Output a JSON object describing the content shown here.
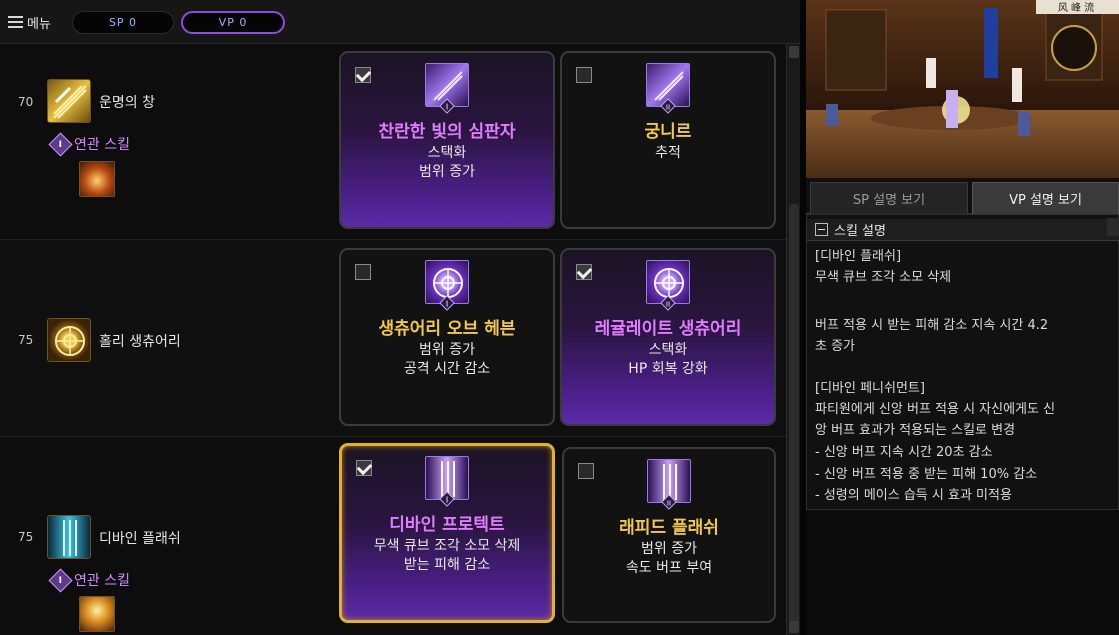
{
  "topbar": {
    "menu_label": "메뉴",
    "sp_label": "SP 0",
    "vp_label": "VP 0"
  },
  "rows": [
    {
      "level": "70",
      "skill_name": "운명의 창",
      "related_label": "연관 스킬",
      "related_roman": "I",
      "cards": [
        {
          "checked": true,
          "roman": "I",
          "title": "찬란한 빛의 심판자",
          "lines": [
            "스택화",
            "범위 증가"
          ]
        },
        {
          "checked": false,
          "roman": "II",
          "title": "궁니르",
          "lines": [
            "추적"
          ]
        }
      ]
    },
    {
      "level": "75",
      "skill_name": "홀리 생츄어리",
      "cards": [
        {
          "checked": false,
          "roman": "I",
          "title": "생츄어리 오브 헤븐",
          "lines": [
            "범위 증가",
            "공격 시간 감소"
          ]
        },
        {
          "checked": true,
          "roman": "II",
          "title": "레귤레이트 생츄어리",
          "lines": [
            "스택화",
            "HP 회복 강화"
          ]
        }
      ]
    },
    {
      "level": "75",
      "skill_name": "디바인 플래쉬",
      "related_label": "연관 스킬",
      "related_roman": "I",
      "cards": [
        {
          "checked": true,
          "roman": "I",
          "title": "디바인 프로텍트",
          "lines": [
            "무색 큐브 조각 소모 삭제",
            "받는 피해 감소"
          ]
        },
        {
          "checked": false,
          "roman": "II",
          "title": "래피드 플래쉬",
          "lines": [
            "범위 증가",
            "속도 버프 부여"
          ]
        }
      ]
    }
  ],
  "right": {
    "preview_sign": "风 峰 流",
    "tab_sp": "SP 설명 보기",
    "tab_vp": "VP 설명 보기",
    "desc_title": "스킬 설명",
    "desc_lines": [
      "[디바인 플래쉬]",
      "무색 큐브 조각 소모 삭제",
      "",
      "버프 적용 시 받는 피해 감소 지속 시간 4.2",
      "초 증가",
      "",
      "[디바인 페니쉬먼트]",
      "파티원에게 신앙 버프 적용 시 자신에게도 신",
      "앙 버프 효과가 적용되는 스킬로 변경",
      "- 신앙 버프 지속 시간 20초 감소",
      "- 신앙 버프 적용 중 받는 피해 10% 감소",
      "- 성령의 메이스 습득 시 효과 미적용"
    ]
  },
  "colors": {
    "accent_gold": "#e1b22c",
    "accent_violet": "#e07cff",
    "title_yellow": "#f2c94c"
  }
}
